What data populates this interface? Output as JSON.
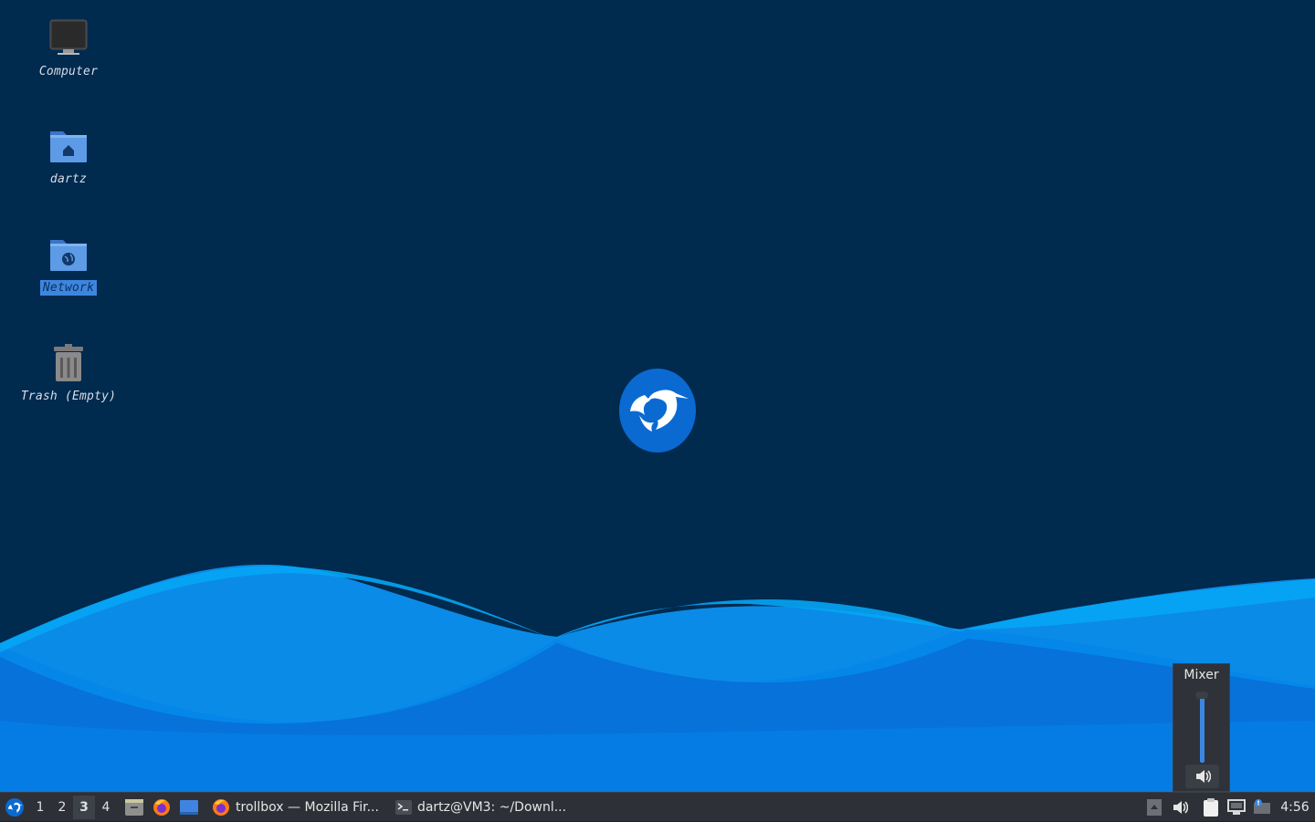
{
  "desktop": {
    "icons": [
      {
        "label": "Computer"
      },
      {
        "label": "dartz"
      },
      {
        "label": "Network"
      },
      {
        "label": "Trash (Empty)"
      }
    ],
    "selected_icon": "Network"
  },
  "taskbar": {
    "workspaces": [
      "1",
      "2",
      "3",
      "4"
    ],
    "active_workspace": "3",
    "launchers": [
      "file-manager-icon",
      "firefox-icon",
      "show-desktop-icon"
    ],
    "tasks": [
      {
        "label": "trollbox — Mozilla Fir...",
        "icon": "firefox-icon"
      },
      {
        "label": "dartz@VM3: ~/Downl...",
        "icon": "terminal-icon"
      }
    ],
    "tray": [
      "tray-up-icon",
      "volume-icon",
      "clipboard-icon",
      "network-icon",
      "notification-icon"
    ],
    "clock": "4:56"
  },
  "mixer": {
    "title": "Mixer",
    "volume_fraction": 0.95
  },
  "colors": {
    "background": "#012a4f",
    "wave_light": "#05a1f3",
    "wave_dark": "#0274d8",
    "accent": "#3d86e0",
    "taskbar": "#2d3036"
  }
}
